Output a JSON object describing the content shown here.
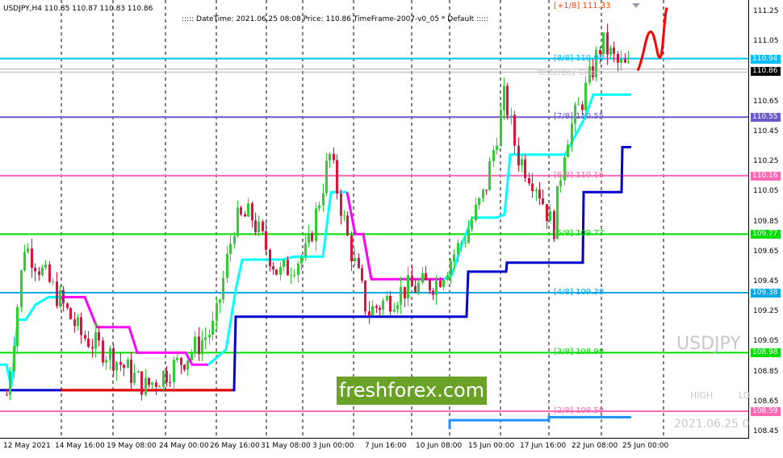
{
  "header": {
    "symbol_info": "USDJPY,H4  110.85 110.87 110.83 110.86",
    "info_line": ":::::  DateTime: 2021.06.25 08:08   Price: 110.86   TimeFrame-2007-v0_05   *  Default  :::::"
  },
  "watermarks": {
    "symbol": "USDJPY",
    "high": "HIGH",
    "low": "LO",
    "date": "2021.06.25 0",
    "yesterday": "Yesterday Close"
  },
  "brand": "freshforex.com",
  "price_axis": {
    "ticks": [
      "111.25",
      "111.05",
      "110.85",
      "110.65",
      "110.45",
      "110.25",
      "110.05",
      "109.85",
      "109.65",
      "109.45",
      "109.25",
      "109.05",
      "108.85",
      "108.65",
      "108.45"
    ],
    "current_price": "110.86"
  },
  "levels": [
    {
      "name": "+1/8",
      "label": "[+1/8]",
      "value": "111.33",
      "color": "#ff4500"
    },
    {
      "name": "8/8",
      "label": "[8/8]",
      "value": "110.94",
      "color": "#00bfff"
    },
    {
      "name": "7/8",
      "label": "[7/8]",
      "value": "110.55",
      "color": "#6a5acd"
    },
    {
      "name": "6/8",
      "label": "[6/8]",
      "value": "110.16",
      "color": "#ff69b4"
    },
    {
      "name": "5/8",
      "label": "[5/8]",
      "value": "109.77",
      "color": "#00dd00"
    },
    {
      "name": "4/8",
      "label": "[4/8]",
      "value": "109.38",
      "color": "#00a8e8"
    },
    {
      "name": "3/8",
      "label": "[3/8]",
      "value": "108.98",
      "color": "#00dd00"
    },
    {
      "name": "2/8",
      "label": "[2/8]",
      "value": "108.59",
      "color": "#ff69b4"
    }
  ],
  "time_axis": [
    "12 May 2021",
    "14 May 16:00",
    "19 May 08:00",
    "24 May 00:00",
    "26 May 16:00",
    "31 May 08:00",
    "3 Jun 00:00",
    "7 Jun 16:00",
    "10 Jun 08:00",
    "15 Jun 00:00",
    "17 Jun 16:00",
    "22 Jun 08:00",
    "25 Jun 00:00"
  ],
  "colors": {
    "bull": "#32cd32",
    "bear": "#dc143c",
    "forecast": "#ff0000",
    "trend_slow": "#0000cd",
    "trend_fast_bull": "#00ffff",
    "trend_fast_bear": "#ff00ff"
  },
  "chart_data": {
    "type": "candlestick",
    "symbol": "USDJPY",
    "timeframe": "H4",
    "ylim": [
      108.4,
      111.35
    ],
    "murrey_levels": [
      111.33,
      110.94,
      110.55,
      110.16,
      109.77,
      109.38,
      108.98,
      108.59
    ],
    "last": {
      "open": 110.85,
      "high": 110.87,
      "low": 110.83,
      "close": 110.86
    }
  }
}
